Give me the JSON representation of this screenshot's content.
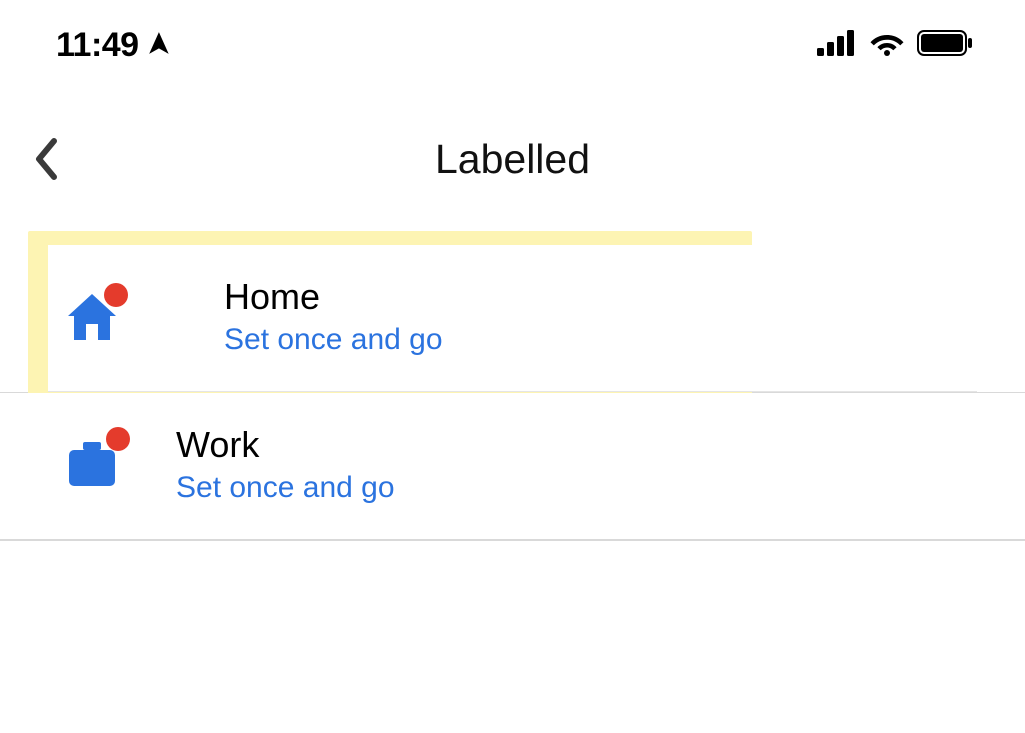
{
  "status": {
    "time": "11:49"
  },
  "header": {
    "title": "Labelled"
  },
  "colors": {
    "link_blue": "#2b73df",
    "icon_blue": "#2b73df",
    "notification_red": "#e43b2c",
    "highlight_yellow": "#fdf4b3"
  },
  "rows": [
    {
      "icon": "home-icon",
      "title": "Home",
      "subtitle": "Set once and go",
      "highlighted": true,
      "has_notification": true
    },
    {
      "icon": "briefcase-icon",
      "title": "Work",
      "subtitle": "Set once and go",
      "highlighted": false,
      "has_notification": true
    }
  ]
}
